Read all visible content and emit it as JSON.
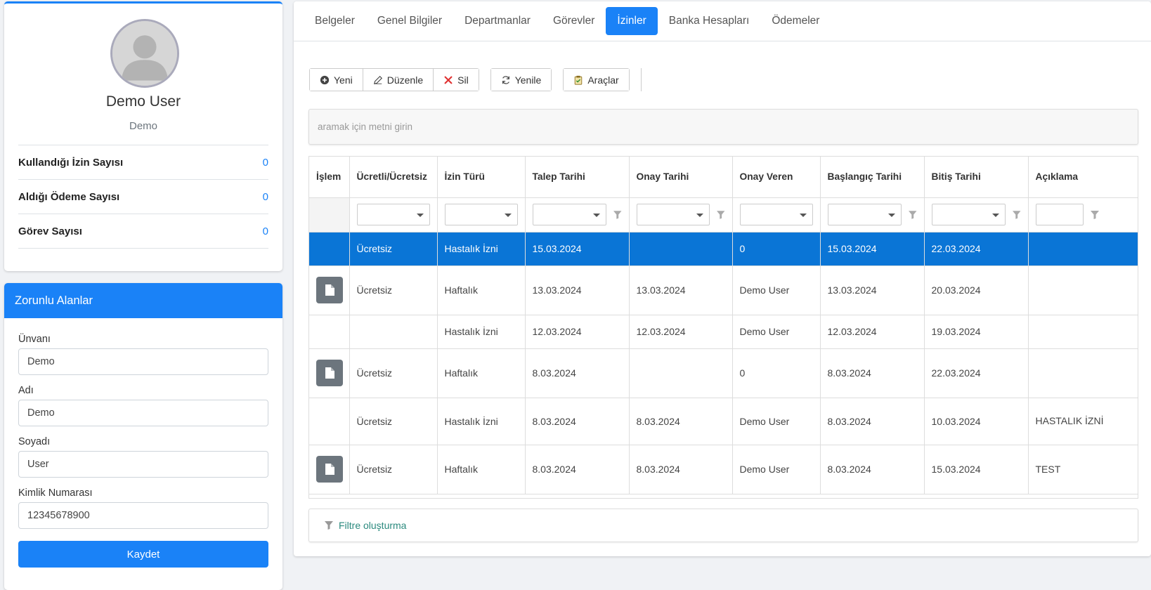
{
  "profile": {
    "name": "Demo User",
    "subtitle": "Demo",
    "stats": [
      {
        "label": "Kullandığı İzin Sayısı",
        "value": "0"
      },
      {
        "label": "Aldığı Ödeme Sayısı",
        "value": "0"
      },
      {
        "label": "Görev Sayısı",
        "value": "0"
      }
    ]
  },
  "form": {
    "title": "Zorunlu Alanlar",
    "fields": [
      {
        "label": "Ünvanı",
        "value": "Demo"
      },
      {
        "label": "Adı",
        "value": "Demo"
      },
      {
        "label": "Soyadı",
        "value": "User"
      },
      {
        "label": "Kimlik Numarası",
        "value": "12345678900"
      }
    ],
    "save_label": "Kaydet"
  },
  "tabs": [
    {
      "label": "Belgeler",
      "active": false
    },
    {
      "label": "Genel Bilgiler",
      "active": false
    },
    {
      "label": "Departmanlar",
      "active": false
    },
    {
      "label": "Görevler",
      "active": false
    },
    {
      "label": "İzinler",
      "active": true
    },
    {
      "label": "Banka Hesapları",
      "active": false
    },
    {
      "label": "Ödemeler",
      "active": false
    }
  ],
  "toolbar": {
    "new_label": "Yeni",
    "edit_label": "Düzenle",
    "delete_label": "Sil",
    "refresh_label": "Yenile",
    "tools_label": "Araçlar"
  },
  "search": {
    "placeholder": "aramak için metni girin"
  },
  "grid": {
    "columns": [
      "İşlem",
      "Ücretli/Ücretsiz",
      "İzin Türü",
      "Talep Tarihi",
      "Onay Tarihi",
      "Onay Veren",
      "Başlangıç Tarihi",
      "Bitiş Tarihi",
      "Açıklama"
    ],
    "rows": [
      {
        "action": false,
        "paid": "Ücretsiz",
        "type": "Hastalık İzni",
        "request": "15.03.2024",
        "approval": "",
        "approver": "0",
        "start": "15.03.2024",
        "end": "22.03.2024",
        "note": ""
      },
      {
        "action": true,
        "paid": "Ücretsiz",
        "type": "Haftalık",
        "request": "13.03.2024",
        "approval": "13.03.2024",
        "approver": "Demo User",
        "start": "13.03.2024",
        "end": "20.03.2024",
        "note": ""
      },
      {
        "action": false,
        "paid": "",
        "type": "Hastalık İzni",
        "request": "12.03.2024",
        "approval": "12.03.2024",
        "approver": "Demo User",
        "start": "12.03.2024",
        "end": "19.03.2024",
        "note": ""
      },
      {
        "action": true,
        "paid": "Ücretsiz",
        "type": "Haftalık",
        "request": "8.03.2024",
        "approval": "",
        "approver": "0",
        "start": "8.03.2024",
        "end": "22.03.2024",
        "note": ""
      },
      {
        "action": false,
        "paid": "Ücretsiz",
        "type": "Hastalık İzni",
        "request": "8.03.2024",
        "approval": "8.03.2024",
        "approver": "Demo User",
        "start": "8.03.2024",
        "end": "10.03.2024",
        "note": "HASTALIK İZNİ"
      },
      {
        "action": true,
        "paid": "Ücretsiz",
        "type": "Haftalık",
        "request": "8.03.2024",
        "approval": "8.03.2024",
        "approver": "Demo User",
        "start": "8.03.2024",
        "end": "15.03.2024",
        "note": "TEST"
      }
    ]
  },
  "filter_builder": {
    "label": "Filtre oluşturma"
  },
  "colors": {
    "accent": "#1a82f7",
    "selected_row": "#0a75d6",
    "action_button": "#6c757d",
    "filter_link": "#2b8a7e"
  },
  "icons": [
    "user-avatar-icon",
    "plus-circle-icon",
    "pencil-icon",
    "x-icon",
    "refresh-icon",
    "clipboard-check-icon",
    "funnel-icon",
    "document-icon",
    "chevron-down-icon"
  ]
}
